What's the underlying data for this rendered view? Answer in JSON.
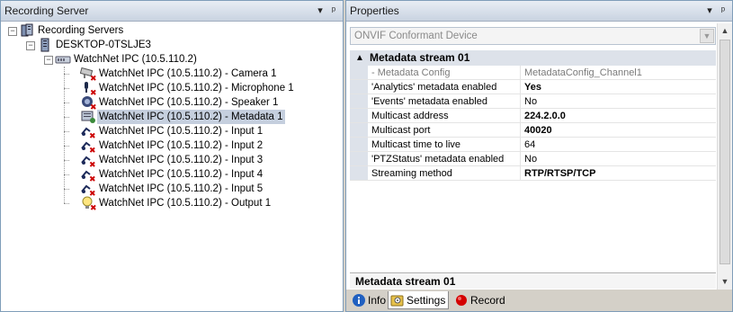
{
  "left_pane": {
    "title": "Recording Server",
    "dropdown_icon": "dropdown-arrow-icon",
    "pin_icon": "pin-icon",
    "tree": [
      {
        "label": "Recording Servers",
        "icon": "recording-servers-icon",
        "expander": "−",
        "level": 0
      },
      {
        "label": "DESKTOP-0TSLJE3",
        "icon": "server-icon",
        "expander": "−",
        "level": 1
      },
      {
        "label": "WatchNet IPC (10.5.110.2)",
        "icon": "hardware-device-icon",
        "expander": "−",
        "level": 2
      },
      {
        "label": "WatchNet IPC (10.5.110.2) - Camera 1",
        "icon": "camera-disabled-icon",
        "level": 3
      },
      {
        "label": "WatchNet IPC (10.5.110.2) - Microphone 1",
        "icon": "microphone-disabled-icon",
        "level": 3
      },
      {
        "label": "WatchNet IPC (10.5.110.2) - Speaker 1",
        "icon": "speaker-disabled-icon",
        "level": 3
      },
      {
        "label": "WatchNet IPC (10.5.110.2) - Metadata 1",
        "icon": "metadata-icon",
        "level": 3,
        "selected": true
      },
      {
        "label": "WatchNet IPC (10.5.110.2) - Input 1",
        "icon": "input-disabled-icon",
        "level": 3
      },
      {
        "label": "WatchNet IPC (10.5.110.2) - Input 2",
        "icon": "input-disabled-icon",
        "level": 3
      },
      {
        "label": "WatchNet IPC (10.5.110.2) - Input 3",
        "icon": "input-disabled-icon",
        "level": 3
      },
      {
        "label": "WatchNet IPC (10.5.110.2) - Input 4",
        "icon": "input-disabled-icon",
        "level": 3
      },
      {
        "label": "WatchNet IPC (10.5.110.2) - Input 5",
        "icon": "input-disabled-icon",
        "level": 3
      },
      {
        "label": "WatchNet IPC (10.5.110.2) - Output 1",
        "icon": "output-disabled-icon",
        "level": 3
      }
    ]
  },
  "right_pane": {
    "title": "Properties",
    "dropdown_icon": "dropdown-arrow-icon",
    "pin_icon": "pin-icon",
    "device_combo": "ONVIF Conformant Device",
    "category": {
      "label": "Metadata stream 01",
      "toggle": "▲"
    },
    "properties": [
      {
        "name": "- Metadata Config",
        "value": "MetadataConfig_Channel1",
        "dim": true,
        "bold": false
      },
      {
        "name": "'Analytics' metadata enabled",
        "value": "Yes",
        "dim": false,
        "bold": true
      },
      {
        "name": "'Events' metadata enabled",
        "value": "No",
        "dim": false,
        "bold": false
      },
      {
        "name": "Multicast address",
        "value": "224.2.0.0",
        "dim": false,
        "bold": true
      },
      {
        "name": "Multicast port",
        "value": "40020",
        "dim": false,
        "bold": true
      },
      {
        "name": "Multicast time to live",
        "value": "64",
        "dim": false,
        "bold": false
      },
      {
        "name": "'PTZStatus' metadata enabled",
        "value": "No",
        "dim": false,
        "bold": false
      },
      {
        "name": "Streaming method",
        "value": "RTP/RTSP/TCP",
        "dim": false,
        "bold": true
      }
    ],
    "description_title": "Metadata stream 01",
    "tabs": [
      {
        "label": "Info",
        "icon": "info-icon",
        "active": false
      },
      {
        "label": "Settings",
        "icon": "settings-icon",
        "active": true
      },
      {
        "label": "Record",
        "icon": "record-icon",
        "active": false
      }
    ]
  },
  "colors": {
    "selection": "#c5cfde",
    "header_bg": "#c9d3e1",
    "disabled_badge": "#cc0000",
    "record": "#d40000",
    "info": "#2060c0"
  }
}
